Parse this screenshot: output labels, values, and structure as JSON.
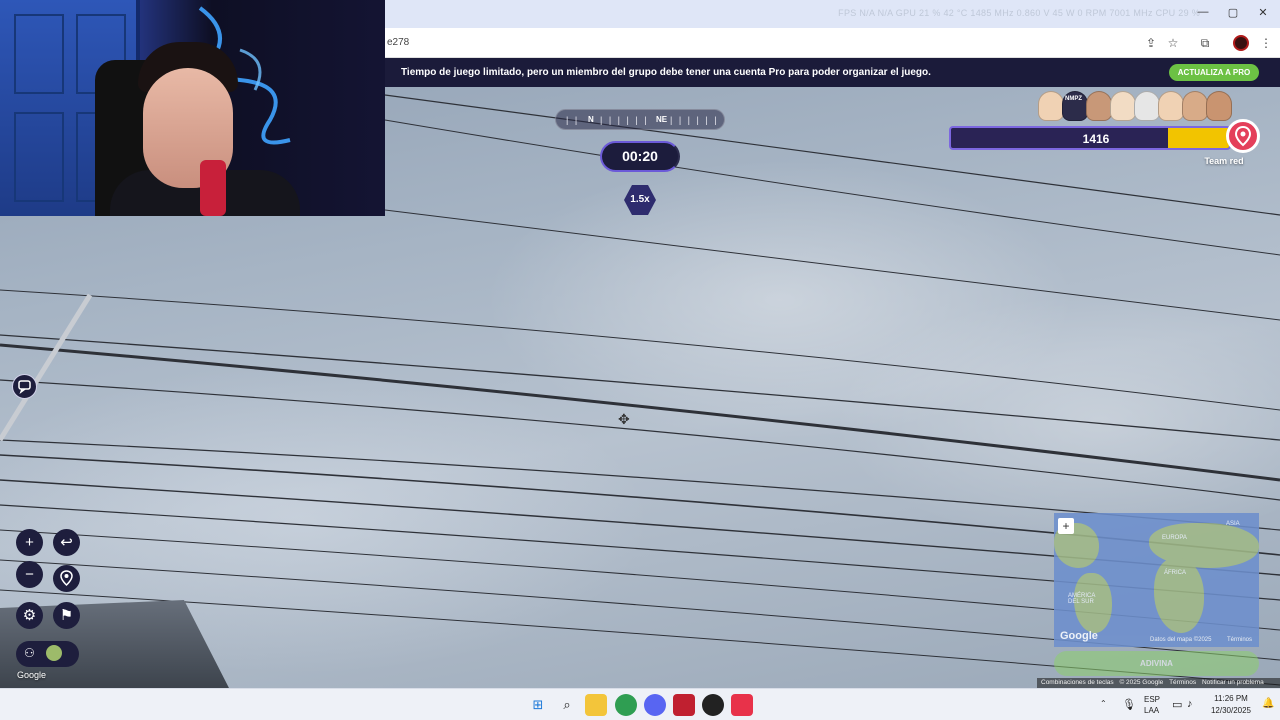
{
  "browser": {
    "url_fragment": "e278",
    "hw_stats": "FPS  N/A  N/A      GPU  21 %  42 °C  1485 MHz  0.860 V  45 W  0 RPM  7001 MHz      CPU  29 %",
    "hw_stats_right": "N/A  N/A",
    "window_buttons": [
      "—",
      "▢",
      "✕"
    ]
  },
  "banner": {
    "text": "Tiempo de juego limitado, pero un miembro del grupo debe tener una cuenta Pro para poder organizar el juego.",
    "upgrade_label": "ACTUALIZA A PRO"
  },
  "compass": {
    "north": "N",
    "northeast": "NE",
    "ticks_left": "|  |",
    "ticks_mid": "| | | | | |",
    "ticks_right": "| | | | | |"
  },
  "game": {
    "timer": "00:20",
    "multiplier": "1.5x",
    "team_score": "1416",
    "team_progress": 0.22,
    "team_name": "Team red",
    "avatar_tag": "NMPZ"
  },
  "controls": {
    "zoom_in": "+",
    "zoom_out": "−",
    "back": "↩",
    "settings": "⚙",
    "flag": "⚑"
  },
  "google_label": "Google",
  "minimap": {
    "zoom_in": "+",
    "labels": [
      "ASIA",
      "EUROPA",
      "ÁFRICA",
      "AMÉRICA DEL SUR"
    ],
    "google": "Google",
    "data_attrib": "Datos del mapa ©2025",
    "terms": "Términos",
    "guess_label": "ADIVINA"
  },
  "footer": {
    "shortcuts": "Combinaciones de teclas",
    "copyright": "© 2025 Google",
    "terms": "Términos",
    "report": "Notificar un problema"
  },
  "taskbar": {
    "lang": "ESP",
    "layout": "LAA",
    "time": "11:26 PM",
    "date": "12/30/2025"
  },
  "colors": {
    "banner_bg": "#1b1b3a",
    "pro_green": "#6cc144",
    "score_yellow": "#f2c400",
    "team_red": "#e43f5a",
    "hud_dark": "#1e1e3d"
  }
}
